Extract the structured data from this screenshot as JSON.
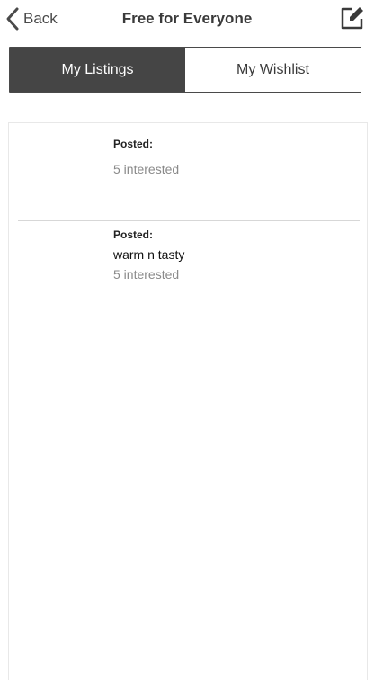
{
  "nav": {
    "back_label": "Back",
    "title": "Free for Everyone",
    "compose_icon": "compose-icon"
  },
  "segments": [
    {
      "label": "My Listings",
      "active": true
    },
    {
      "label": "My Wishlist",
      "active": false
    }
  ],
  "listings": [
    {
      "posted_label": "Posted:",
      "title": "",
      "interested": "5 interested"
    },
    {
      "posted_label": "Posted:",
      "title": "warm n tasty",
      "interested": "5 interested"
    }
  ],
  "colors": {
    "active_segment_bg": "#454545",
    "divider": "#d7d7d7",
    "muted_text": "#8a8a8a"
  }
}
